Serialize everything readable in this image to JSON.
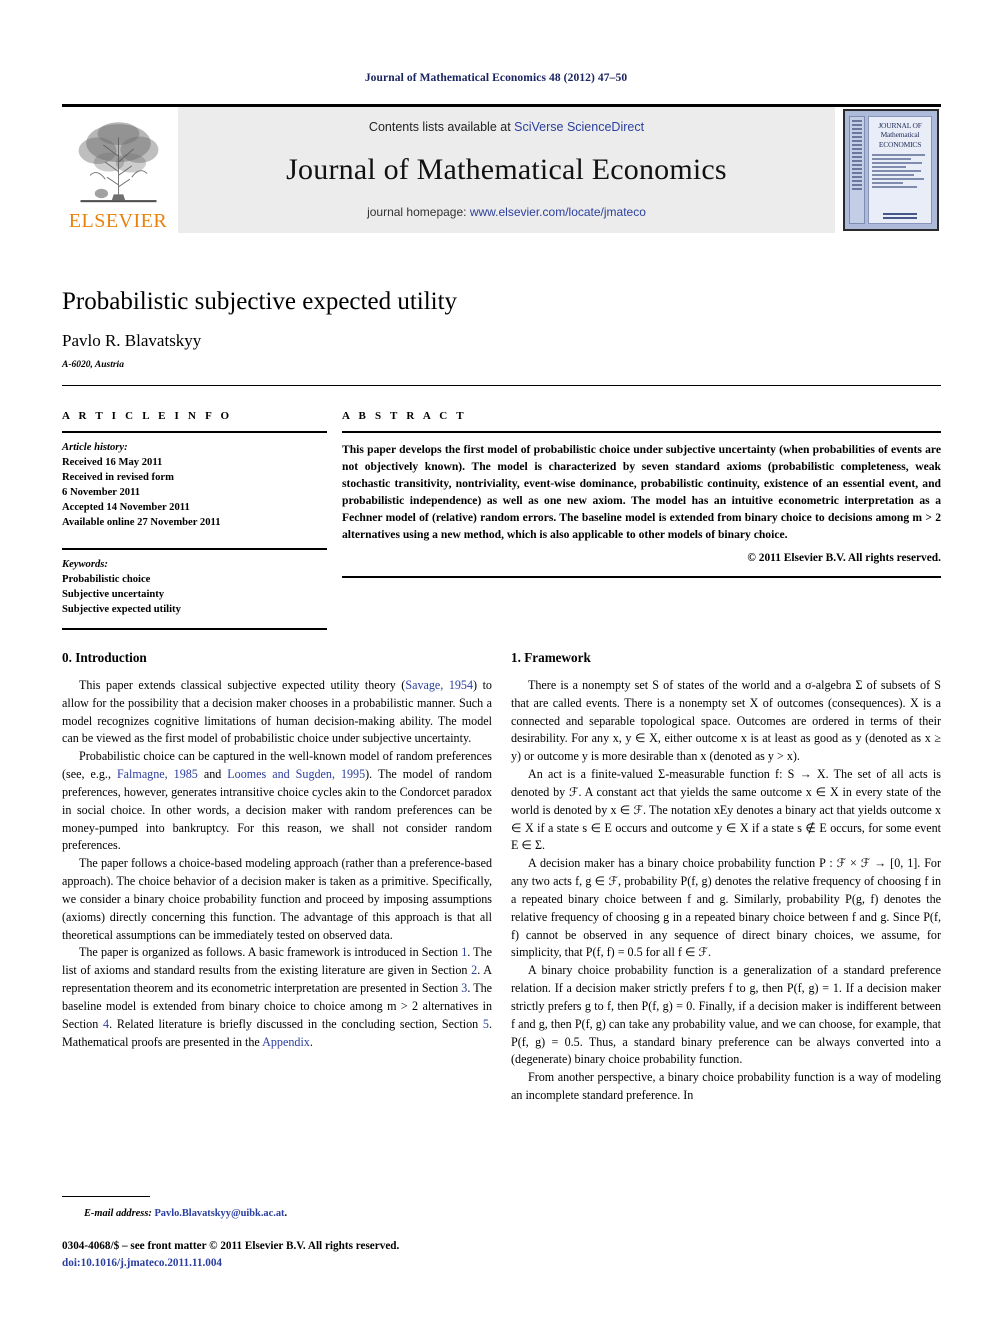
{
  "running_head": "Journal of Mathematical Economics 48 (2012) 47–50",
  "masthead": {
    "publisher_wordmark": "ELSEVIER",
    "contents_prefix": "Contents lists available at ",
    "contents_link": "SciVerse ScienceDirect",
    "journal_title": "Journal of Mathematical Economics",
    "homepage_prefix": "journal homepage: ",
    "homepage_url": "www.elsevier.com/locate/jmateco",
    "cover_title_line1": "JOURNAL OF",
    "cover_title_line2": "Mathematical",
    "cover_title_line3": "ECONOMICS"
  },
  "article": {
    "title": "Probabilistic subjective expected utility",
    "author": "Pavlo R. Blavatskyy",
    "affiliation": "A-6020, Austria"
  },
  "info": {
    "heading": "A R T I C L E    I N F O",
    "history_label": "Article history:",
    "history": [
      "Received 16 May 2011",
      "Received in revised form",
      "6 November 2011",
      "Accepted 14 November 2011",
      "Available online 27 November 2011"
    ],
    "keywords_label": "Keywords:",
    "keywords": [
      "Probabilistic choice",
      "Subjective uncertainty",
      "Subjective expected utility"
    ]
  },
  "abstract": {
    "heading": "A B S T R A C T",
    "text": "This paper develops the first model of probabilistic choice under subjective uncertainty (when probabilities of events are not objectively known). The model is characterized by seven standard axioms (probabilistic completeness, weak stochastic transitivity, nontriviality, event-wise dominance, probabilistic continuity, existence of an essential event, and probabilistic independence) as well as one new axiom. The model has an intuitive econometric interpretation as a Fechner model of (relative) random errors. The baseline model is extended from binary choice to decisions among m > 2 alternatives using a new method, which is also applicable to other models of binary choice.",
    "copyright": "© 2011 Elsevier B.V. All rights reserved."
  },
  "left_column": {
    "heading": "0. Introduction",
    "p1_a": "This paper extends classical subjective expected utility theory (",
    "p1_cite1": "Savage, 1954",
    "p1_b": ") to allow for the possibility that a decision maker chooses in a probabilistic manner. Such a model recognizes cognitive limitations of human decision-making ability. The model can be viewed as the first model of probabilistic choice under subjective uncertainty.",
    "p2_a": "Probabilistic choice can be captured in the well-known model of random preferences (see, e.g., ",
    "p2_cite1": "Falmagne, 1985",
    "p2_b": " and ",
    "p2_cite2": "Loomes and Sugden, 1995",
    "p2_c": "). The model of random preferences, however, generates intransitive choice cycles akin to the Condorcet paradox in social choice. In other words, a decision maker with random preferences can be money-pumped into bankruptcy. For this reason, we shall not consider random preferences.",
    "p3": "The paper follows a choice-based modeling approach (rather than a preference-based approach). The choice behavior of a decision maker is taken as a primitive. Specifically, we consider a binary choice probability function and proceed by imposing assumptions (axioms) directly concerning this function. The advantage of this approach is that all theoretical assumptions can be immediately tested on observed data.",
    "p4_a": "The paper is organized as follows. A basic framework is introduced in Section ",
    "p4_s1": "1",
    "p4_b": ". The list of axioms and standard results from the existing literature are given in Section ",
    "p4_s2": "2",
    "p4_c": ". A representation theorem and its econometric interpretation are presented in Section ",
    "p4_s3": "3",
    "p4_d": ". The baseline model is extended from binary choice to choice among m > 2 alternatives in Section ",
    "p4_s4": "4",
    "p4_e": ". Related literature is briefly discussed in the concluding section, Section ",
    "p4_s5": "5",
    "p4_f": ". Mathematical proofs are presented in the ",
    "p4_appendix": "Appendix",
    "p4_g": "."
  },
  "right_column": {
    "heading": "1. Framework",
    "p1": "There is a nonempty set S of states of the world and a σ-algebra Σ of subsets of S that are called events. There is a nonempty set X of outcomes (consequences). X is a connected and separable topological space. Outcomes are ordered in terms of their desirability. For any x, y ∈ X, either outcome x is at least as good as y (denoted as x ≥ y) or outcome y is more desirable than x (denoted as y > x).",
    "p2": "An act is a finite-valued Σ-measurable function f: S → X. The set of all acts is denoted by ℱ. A constant act that yields the same outcome x ∈ X in every state of the world is denoted by x ∈ ℱ. The notation xEy denotes a binary act that yields outcome x ∈ X if a state s ∈ E occurs and outcome y ∈ X if a state s ∉ E occurs, for some event E ∈ Σ.",
    "p3": "A decision maker has a binary choice probability function P : ℱ × ℱ → [0, 1]. For any two acts f, g ∈ ℱ, probability P(f, g) denotes the relative frequency of choosing f in a repeated binary choice between f and g. Similarly, probability P(g, f) denotes the relative frequency of choosing g in a repeated binary choice between f and g. Since P(f, f) cannot be observed in any sequence of direct binary choices, we assume, for simplicity, that P(f, f) = 0.5 for all f ∈ ℱ.",
    "p4": "A binary choice probability function is a generalization of a standard preference relation. If a decision maker strictly prefers f to g, then P(f, g) = 1. If a decision maker strictly prefers g to f, then P(f, g) = 0. Finally, if a decision maker is indifferent between f and g, then P(f, g) can take any probability value, and we can choose, for example, that P(f, g) = 0.5. Thus, a standard binary preference can be always converted into a (degenerate) binary choice probability function.",
    "p5": "From another perspective, a binary choice probability function is a way of modeling an incomplete standard preference. In"
  },
  "footer": {
    "email_label": "E-mail address:",
    "email": "Pavlo.Blavatskyy@uibk.ac.at",
    "email_tail": ".",
    "issn_line": "0304-4068/$ – see front matter © 2011 Elsevier B.V. All rights reserved.",
    "doi": "doi:10.1016/j.jmateco.2011.11.004"
  },
  "colors": {
    "link": "#2b3f9e",
    "runhead": "#1a2461",
    "elsevier_orange": "#E8820C",
    "banner_bg": "#ececec"
  }
}
